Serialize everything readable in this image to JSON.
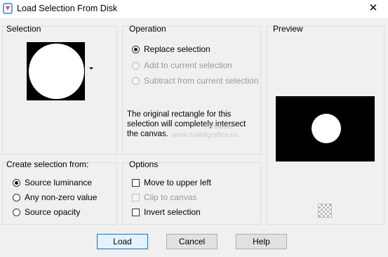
{
  "window": {
    "title": "Load Selection From Disk",
    "close_glyph": "✕"
  },
  "selection": {
    "label": "Selection"
  },
  "operation": {
    "label": "Operation",
    "options": [
      {
        "label": "Replace selection",
        "checked": true,
        "enabled": true
      },
      {
        "label": "Add to current selection",
        "checked": false,
        "enabled": false
      },
      {
        "label": "Subtract from current selection",
        "checked": false,
        "enabled": false
      }
    ],
    "info_line1": "The original rectangle for this",
    "info_line2": "selection will completely intersect",
    "info_line3": "the canvas."
  },
  "preview": {
    "label": "Preview"
  },
  "create_from": {
    "label": "Create selection from:",
    "options": [
      {
        "label": "Source luminance",
        "checked": true
      },
      {
        "label": "Any non-zero value",
        "checked": false
      },
      {
        "label": "Source opacity",
        "checked": false
      }
    ]
  },
  "options": {
    "label": "Options",
    "items": [
      {
        "label": "Move to upper left",
        "checked": false,
        "enabled": true
      },
      {
        "label": "Clip to canvas",
        "checked": false,
        "enabled": false
      },
      {
        "label": "Invert selection",
        "checked": false,
        "enabled": true
      }
    ]
  },
  "watermark": {
    "name": "Pinuccia",
    "url": "www.maildigrafica.eu"
  },
  "buttons": {
    "load": "Load",
    "cancel": "Cancel",
    "help": "Help"
  },
  "icons": {
    "app": "selection-app-icon",
    "preview_toggle": "checkerboard-icon"
  }
}
